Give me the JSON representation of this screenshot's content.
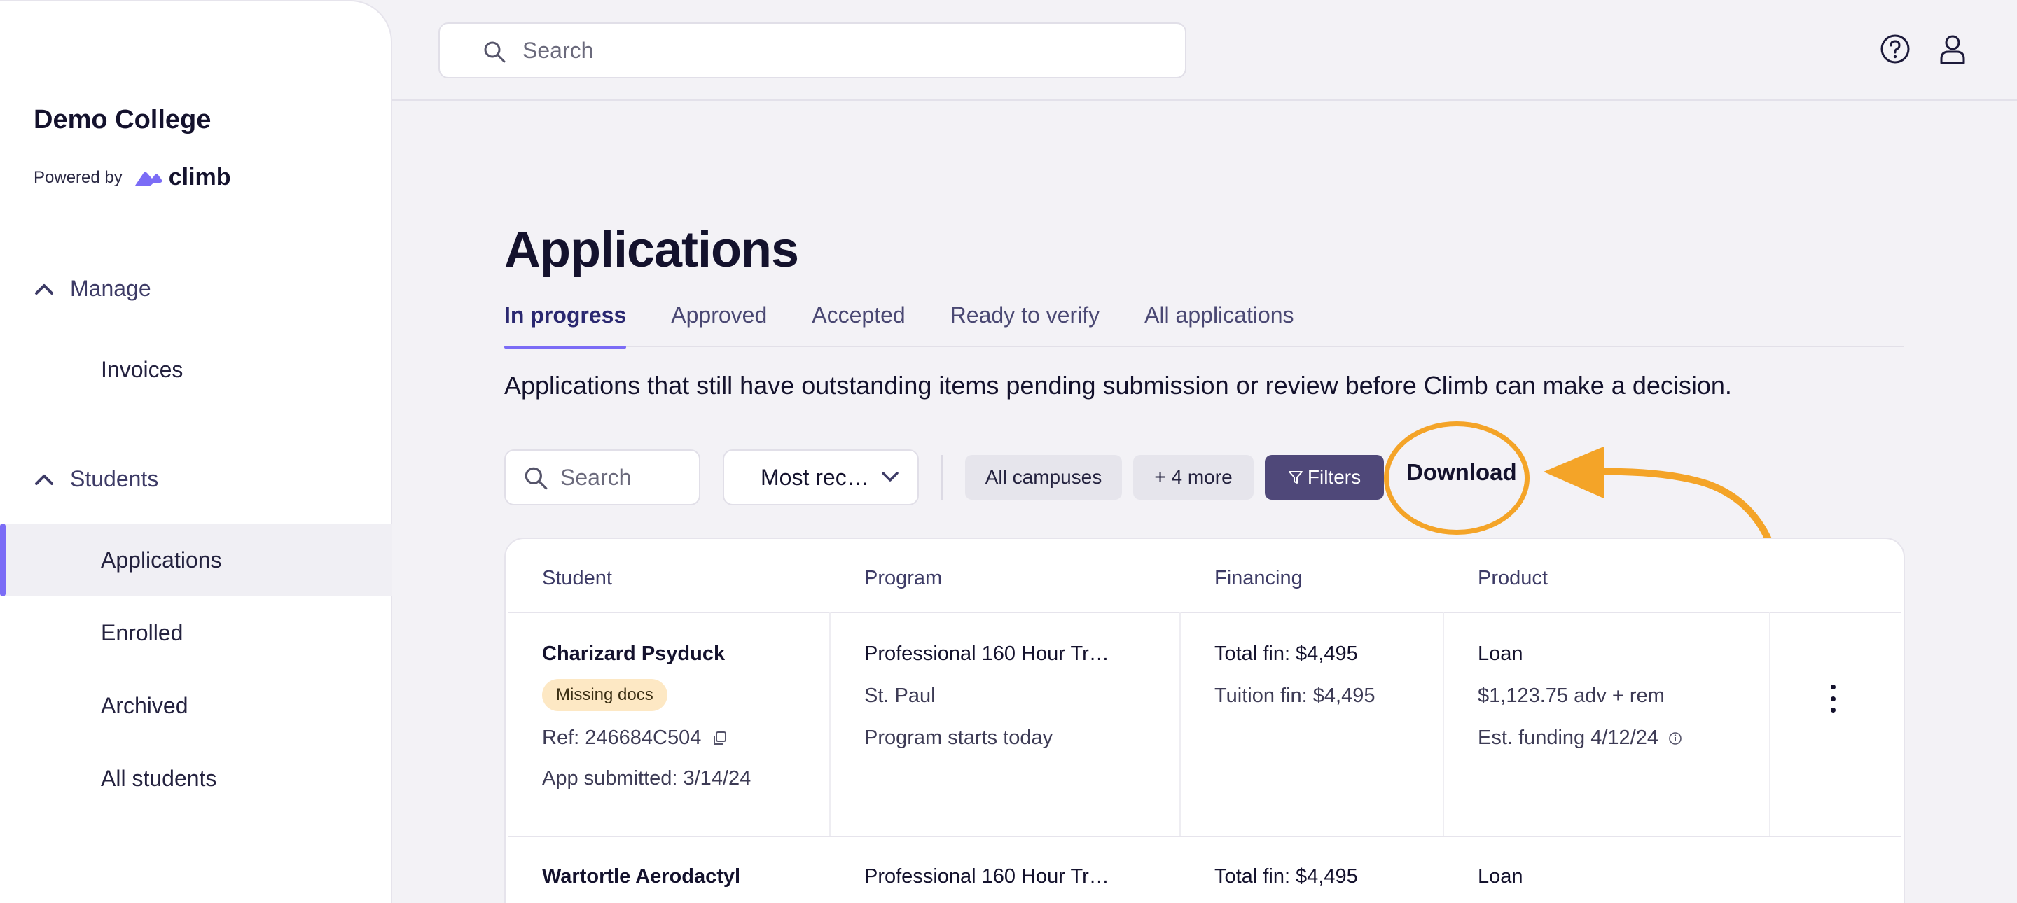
{
  "sidebar": {
    "org_name": "Demo College",
    "powered_by": "Powered by",
    "brand": "climb",
    "brand_color": "#7b6cf6",
    "groups": [
      {
        "label": "Manage",
        "icon": "chevron-up-icon",
        "items": [
          {
            "label": "Invoices"
          }
        ]
      },
      {
        "label": "Students",
        "icon": "chevron-up-icon",
        "items": [
          {
            "label": "Applications",
            "active": true
          },
          {
            "label": "Enrolled"
          },
          {
            "label": "Archived"
          },
          {
            "label": "All students"
          }
        ]
      }
    ]
  },
  "topbar": {
    "search_placeholder": "Search",
    "icons": [
      "help-icon",
      "user-icon"
    ]
  },
  "page": {
    "title": "Applications",
    "tabs": [
      {
        "label": "In progress",
        "active": true
      },
      {
        "label": "Approved"
      },
      {
        "label": "Accepted"
      },
      {
        "label": "Ready to verify"
      },
      {
        "label": "All applications"
      }
    ],
    "description": "Applications that still have outstanding items pending submission or review before Climb can make a decision."
  },
  "toolbar": {
    "search_placeholder": "Search",
    "sort_value": "Most rec…",
    "chips": [
      "All campuses",
      "+ 4 more"
    ],
    "filters_label": "Filters",
    "download_label": "Download",
    "highlight_color": "#f4a428"
  },
  "table": {
    "columns": [
      "Student",
      "Program",
      "Financing",
      "Product"
    ],
    "rows": [
      {
        "student": "Charizard Psyduck",
        "badge": "Missing docs",
        "ref": "Ref: 246684C504",
        "submitted": "App submitted: 3/14/24",
        "program": "Professional 160 Hour Tr…",
        "campus": "St. Paul",
        "program_status": "Program starts today",
        "total_fin": "Total fin: $4,495",
        "tuition_fin": "Tuition fin: $4,495",
        "product": "Loan",
        "product_amount": "$1,123.75 adv + rem",
        "est_funding": "Est. funding 4/12/24"
      },
      {
        "student": "Wartortle Aerodactyl",
        "program": "Professional 160 Hour Tr…",
        "total_fin": "Total fin: $4,495",
        "product": "Loan"
      }
    ]
  }
}
